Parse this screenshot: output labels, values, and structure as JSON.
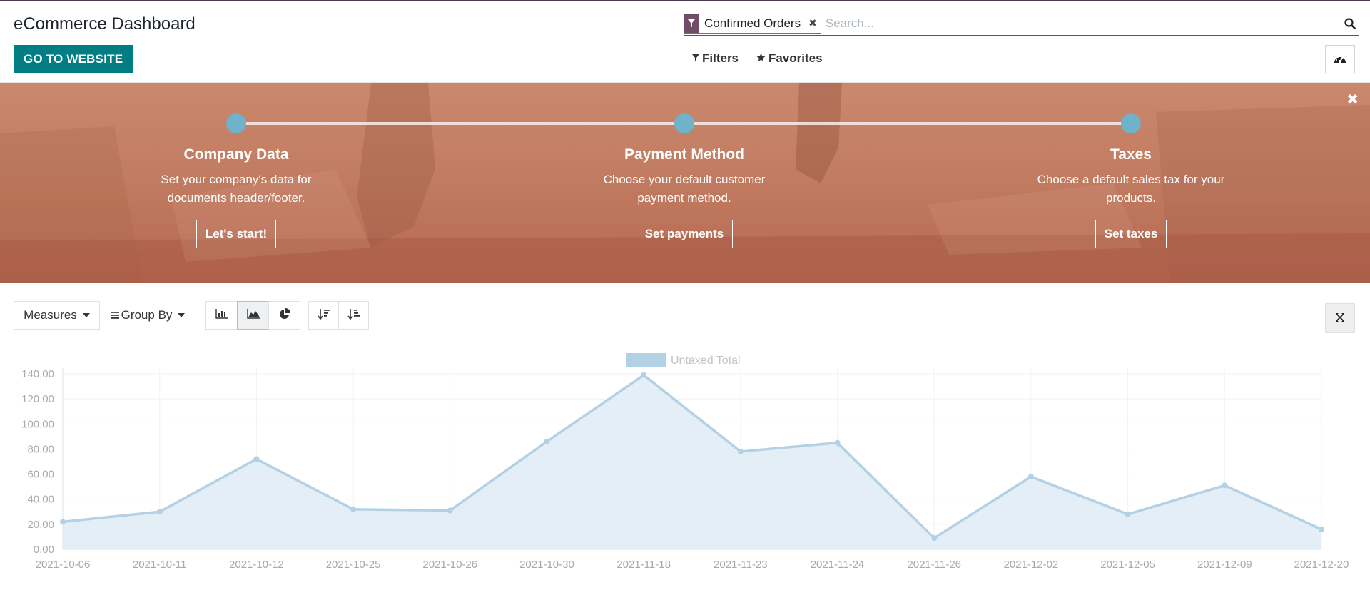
{
  "header": {
    "title": "eCommerce Dashboard",
    "go_to_website": "GO TO WEBSITE"
  },
  "search": {
    "facet_label": "Confirmed Orders",
    "placeholder": "Search...",
    "icon": "search-icon"
  },
  "filters_label": "Filters",
  "favorites_label": "Favorites",
  "onboarding": {
    "steps": [
      {
        "title": "Company Data",
        "line1": "Set your company's data for",
        "line2": "documents header/footer.",
        "button": "Let's start!"
      },
      {
        "title": "Payment Method",
        "line1": "Choose your default customer",
        "line2": "payment method.",
        "button": "Set payments"
      },
      {
        "title": "Taxes",
        "line1": "Choose a default sales tax for your",
        "line2": "products.",
        "button": "Set taxes"
      }
    ],
    "colors": {
      "dot": "#6fb2c9"
    }
  },
  "toolbar": {
    "measures": "Measures",
    "group_by": "Group By"
  },
  "colors": {
    "brand": "#017e84",
    "facet": "#714b67",
    "series_line": "#b3d1e5",
    "series_fill": "#e1ecf5"
  },
  "chart_data": {
    "type": "area",
    "legend": "Untaxed Total",
    "categories": [
      "2021-10-06",
      "2021-10-11",
      "2021-10-12",
      "2021-10-25",
      "2021-10-26",
      "2021-10-30",
      "2021-11-18",
      "2021-11-23",
      "2021-11-24",
      "2021-11-26",
      "2021-12-02",
      "2021-12-05",
      "2021-12-09",
      "2021-12-20"
    ],
    "series": [
      {
        "name": "Untaxed Total",
        "values": [
          22,
          30,
          72,
          32,
          31,
          86,
          139,
          78,
          85,
          9,
          58,
          28,
          51,
          16
        ]
      }
    ],
    "yticks": [
      "0.00",
      "20.00",
      "40.00",
      "60.00",
      "80.00",
      "100.00",
      "120.00",
      "140.00"
    ],
    "ylim": [
      0,
      140
    ],
    "grid": true,
    "legend_position": "top"
  }
}
